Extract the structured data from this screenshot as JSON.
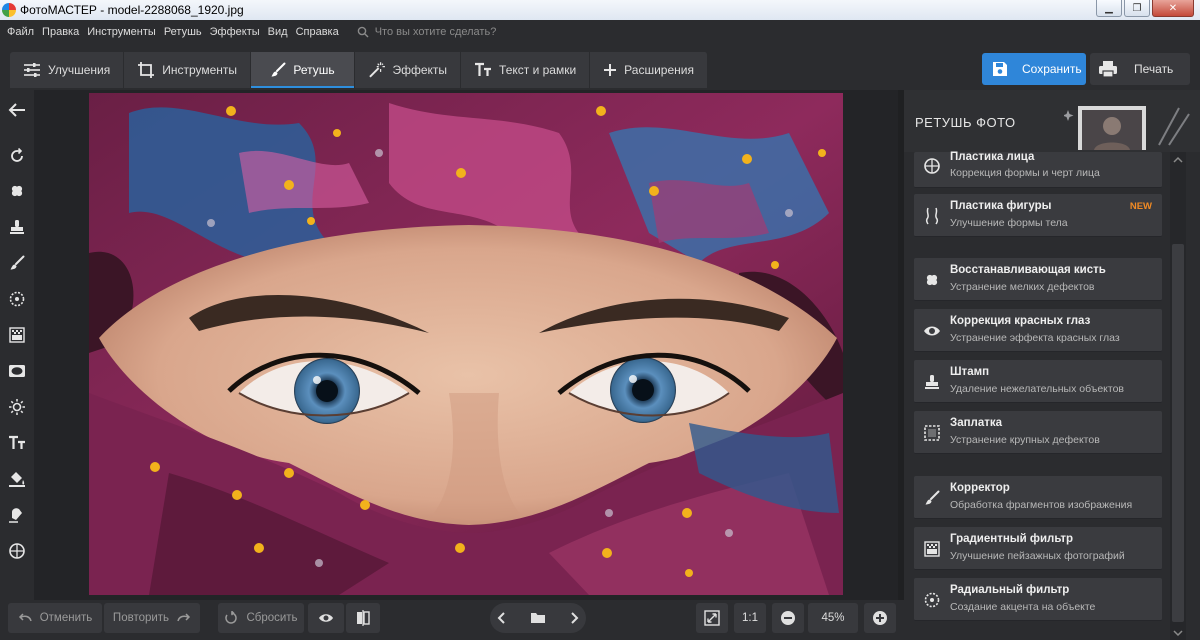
{
  "window": {
    "title": "ФотоМАСТЕР - model-2288068_1920.jpg"
  },
  "menu": {
    "items": [
      "Файл",
      "Правка",
      "Инструменты",
      "Ретушь",
      "Эффекты",
      "Вид",
      "Справка"
    ],
    "search_placeholder": "Что вы хотите сделать?"
  },
  "tabs": [
    {
      "label": "Улучшения",
      "icon": "sliders-icon"
    },
    {
      "label": "Инструменты",
      "icon": "crop-icon"
    },
    {
      "label": "Ретушь",
      "icon": "brush-icon",
      "active": true
    },
    {
      "label": "Эффекты",
      "icon": "magic-wand-icon"
    },
    {
      "label": "Текст и рамки",
      "icon": "text-icon"
    },
    {
      "label": "Расширения",
      "icon": "plus-icon"
    }
  ],
  "actions": {
    "save": "Сохранить",
    "print": "Печать"
  },
  "panel": {
    "title": "РЕТУШЬ ФОТО",
    "tools": [
      {
        "title": "Пластика лица",
        "desc": "Коррекция формы и черт лица",
        "icon": "face-icon"
      },
      {
        "title": "Пластика фигуры",
        "desc": "Улучшение формы тела",
        "icon": "body-icon",
        "badge": "NEW"
      },
      {
        "title": "Восстанавливающая кисть",
        "desc": "Устранение мелких дефектов",
        "icon": "healing-brush-icon"
      },
      {
        "title": "Коррекция красных глаз",
        "desc": "Устранение эффекта красных глаз",
        "icon": "eye-icon"
      },
      {
        "title": "Штамп",
        "desc": "Удаление нежелательных объектов",
        "icon": "stamp-icon"
      },
      {
        "title": "Заплатка",
        "desc": "Устранение крупных дефектов",
        "icon": "patch-icon"
      },
      {
        "title": "Корректор",
        "desc": "Обработка фрагментов изображения",
        "icon": "brush-icon"
      },
      {
        "title": "Градиентный фильтр",
        "desc": "Улучшение пейзажных фотографий",
        "icon": "gradient-icon"
      },
      {
        "title": "Радиальный фильтр",
        "desc": "Создание акцента на объекте",
        "icon": "radial-icon"
      }
    ]
  },
  "bottom": {
    "undo": "Отменить",
    "redo": "Повторить",
    "reset": "Сбросить",
    "zoom_ratio": "1:1",
    "zoom": "45%"
  },
  "colors": {
    "accent": "#2f86d9",
    "badge": "#f08a24",
    "panel_bg": "#2b2c2f",
    "card_bg": "#3a3b3f"
  }
}
